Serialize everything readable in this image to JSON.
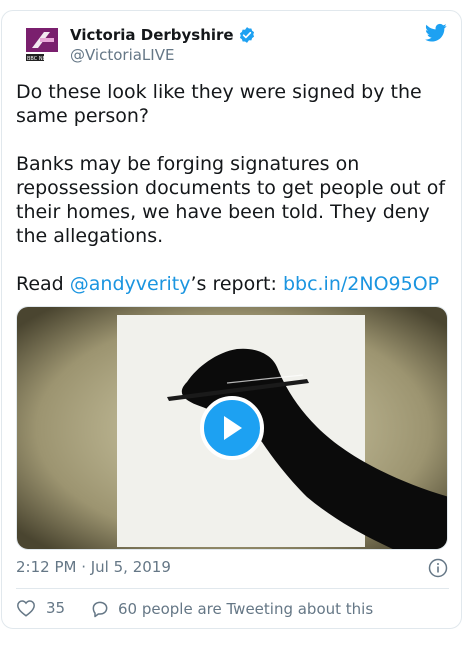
{
  "author": {
    "name": "Victoria Derbyshire",
    "handle": "@VictoriaLIVE",
    "avatar_caption": "BBC NEWS"
  },
  "tweet": {
    "line1": "Do these look like they were signed by the same person?",
    "line2": "Banks may be forging signatures on repossession documents to get people out of their homes, we have been told. They deny the allegations.",
    "read_prefix": "Read ",
    "mention": "@andyverity",
    "report_suffix": "’s report: ",
    "short_link": "bbc.in/2NO95OP"
  },
  "meta": {
    "timestamp": "2:12 PM · Jul 5, 2019"
  },
  "actions": {
    "likes": "35",
    "conversation": "60 people are Tweeting about this"
  },
  "icons": {
    "verified": "verified-badge-icon",
    "platform": "twitter-bird-icon",
    "play": "play-icon",
    "info": "info-icon",
    "like": "heart-icon",
    "reply": "reply-bubble-icon"
  },
  "colors": {
    "link": "#1b95e0",
    "accent": "#1da1f2",
    "secondary_text": "#657786",
    "avatar_purple": "#7a1f6e"
  }
}
